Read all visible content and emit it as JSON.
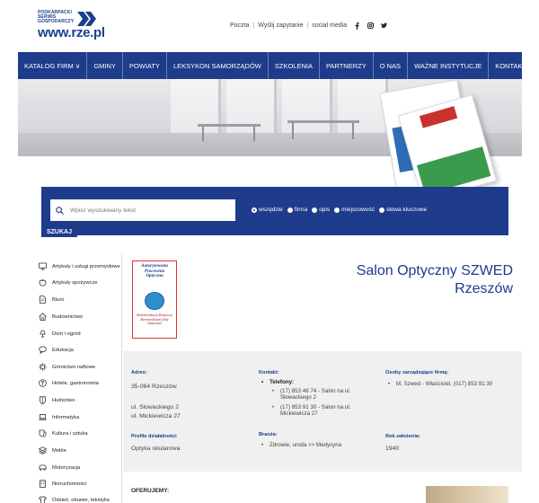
{
  "logo": {
    "line1": "PODKARPACKI",
    "line2": "SERWIS",
    "line3": "GOSPODARCZY",
    "site": "www.rze.pl"
  },
  "toplinks": {
    "poczta": "Poczta",
    "zapytanie": "Wyślij zapytanie",
    "social": "social media",
    "icons": [
      "facebook-icon",
      "instagram-icon",
      "twitter-icon"
    ]
  },
  "nav": {
    "items": [
      "KATALOG FIRM ∨",
      "GMINY",
      "POWIATY",
      "LEKSYKON SAMORZĄDÓW",
      "SZKOLENIA",
      "PARTNERZY",
      "O NAS",
      "WAŻNE INSTYTUCJE",
      "KONTAKT"
    ]
  },
  "search": {
    "placeholder": "Wpisz wyszukiwany tekst",
    "button": "SZUKAJ",
    "options": [
      "wszędzie",
      "firma",
      "opis",
      "miejscowość",
      "słowa kluczowe"
    ],
    "selected": "wszędzie"
  },
  "sidebar": {
    "items": [
      {
        "label": "Artykuły i usługi przemysłowe",
        "icon": "screen-icon"
      },
      {
        "label": "Artykuły spożywcze",
        "icon": "apple-icon"
      },
      {
        "label": "Biuro",
        "icon": "document-icon"
      },
      {
        "label": "Budownictwo",
        "icon": "house-icon"
      },
      {
        "label": "Dom i ogród",
        "icon": "lamp-icon"
      },
      {
        "label": "Edukacja",
        "icon": "speech-icon"
      },
      {
        "label": "Górnictwo naftowe",
        "icon": "gear-icon"
      },
      {
        "label": "Hotele, gastronomia",
        "icon": "fork-icon"
      },
      {
        "label": "Hutnictwo",
        "icon": "shield-icon"
      },
      {
        "label": "Informatyka",
        "icon": "laptop-icon"
      },
      {
        "label": "Kultura i sztuka",
        "icon": "drama-icon"
      },
      {
        "label": "Meble",
        "icon": "layers-icon"
      },
      {
        "label": "Motoryzacja",
        "icon": "car-icon"
      },
      {
        "label": "Nieruchomości",
        "icon": "building-icon"
      },
      {
        "label": "Odzież, obuwie, tekstylia",
        "icon": "shirt-icon"
      }
    ]
  },
  "thumb": {
    "line_top": "Autoryzowana Pracownia Optyczna",
    "line_bottom": "Rekomendacja Krajowej Rzemieślniczej Izby Optycznej"
  },
  "company": {
    "name_line1": "Salon Optyczny SZWED",
    "name_line2": "Rzeszów"
  },
  "info": {
    "adres_label": "Adres:",
    "adres_city": "35-064 Rzeszów",
    "adres_street1": "ul. Słowackiego 2",
    "adres_street2": "ul. Mickiewicza 27",
    "profil_label": "Profile działalności",
    "profil_value": "Optyka okularowa",
    "kontakt_label": "Kontakt:",
    "telefony_label": "Telefony:",
    "phone1": "(17) 853 46 74 - Salon na ul. Słowackiego 2",
    "phone2": "(17) 853 91 30 - Salon na ul. Mickiewicza 27",
    "branza_label": "Branża:",
    "branza_value": "Zdrowie, uroda >> Medycyna",
    "osoby_label": "Osoby zarządzające firmą:",
    "osoby_value": "M. Szwed - Właściciel, (017) 853 91 30",
    "rok_label": "Rok założenia:",
    "rok_value": "1940"
  },
  "offer": {
    "label": "OFERUJEMY:"
  }
}
